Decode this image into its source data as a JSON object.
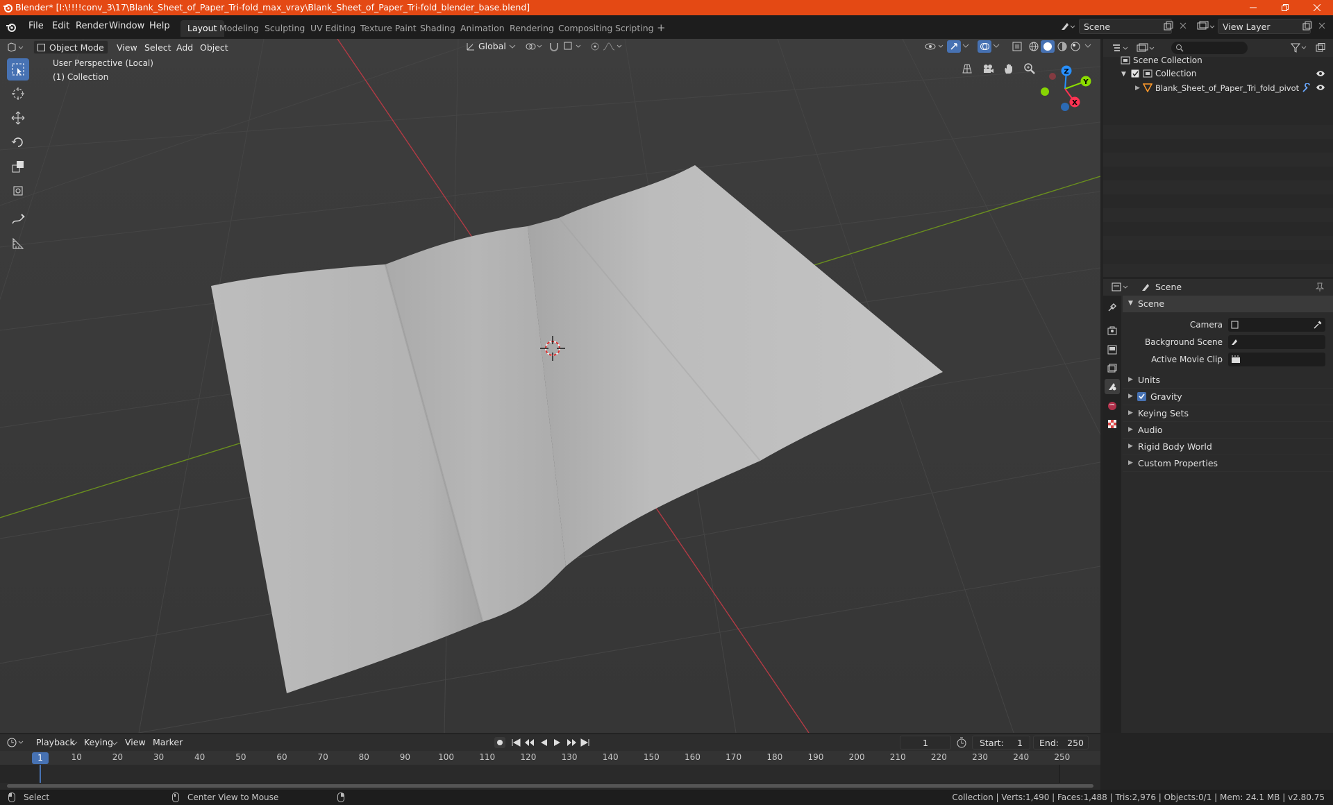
{
  "window": {
    "title": "Blender* [I:\\!!!!conv_3\\17\\Blank_Sheet_of_Paper_Tri-fold_max_vray\\Blank_Sheet_of_Paper_Tri-fold_blender_base.blend]"
  },
  "menus": [
    "File",
    "Edit",
    "Render",
    "Window",
    "Help"
  ],
  "workspaces": [
    "Layout",
    "Modeling",
    "Sculpting",
    "UV Editing",
    "Texture Paint",
    "Shading",
    "Animation",
    "Rendering",
    "Compositing",
    "Scripting"
  ],
  "active_workspace": "Layout",
  "scene_field": "Scene",
  "view_layer_field": "View Layer",
  "viewport": {
    "mode": "Object Mode",
    "menus": [
      "View",
      "Select",
      "Add",
      "Object"
    ],
    "transform_orientation": "Global",
    "overlay_line1": "User Perspective (Local)",
    "overlay_line2": "(1) Collection",
    "gizmo_axes": {
      "z": "Z",
      "y": "Y",
      "x": "X"
    }
  },
  "outliner": {
    "root": "Scene Collection",
    "collection": "Collection",
    "object": "Blank_Sheet_of_Paper_Tri_fold_pivot"
  },
  "properties": {
    "context": "Scene",
    "panel": "Scene",
    "camera_label": "Camera",
    "background_label": "Background Scene",
    "movieclip_label": "Active Movie Clip",
    "sections": [
      "Units",
      "Gravity",
      "Keying Sets",
      "Audio",
      "Rigid Body World",
      "Custom Properties"
    ]
  },
  "timeline": {
    "menus": [
      "Playback",
      "Keying",
      "View",
      "Marker"
    ],
    "current_frame": "1",
    "start_label": "Start:",
    "start": "1",
    "end_label": "End:",
    "end": "250",
    "ticks": [
      "1",
      "10",
      "20",
      "30",
      "40",
      "50",
      "60",
      "70",
      "80",
      "90",
      "100",
      "110",
      "120",
      "130",
      "140",
      "150",
      "160",
      "170",
      "180",
      "190",
      "200",
      "210",
      "220",
      "230",
      "240",
      "250"
    ]
  },
  "status": {
    "select": "Select",
    "center": "Center View to Mouse",
    "stats": "Collection | Verts:1,490 | Faces:1,488 | Tris:2,976 | Objects:0/1 | Mem: 24.1 MB | v2.80.75"
  },
  "colors": {
    "titlebar": "#e44914",
    "accent": "#4772b3",
    "x_axis": "#ff3352",
    "y_axis": "#8bdc00",
    "z_axis": "#2890ff"
  }
}
